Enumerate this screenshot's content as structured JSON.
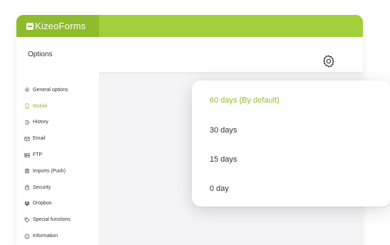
{
  "app": {
    "logo_text": "KizeoForms"
  },
  "header": {
    "title": "Options"
  },
  "sidebar": {
    "items": [
      {
        "label": "General options",
        "icon": "gear-icon"
      },
      {
        "label": "Mobile",
        "icon": "mobile-icon",
        "active": true
      },
      {
        "label": "History",
        "icon": "history-icon"
      },
      {
        "label": "Email",
        "icon": "email-icon"
      },
      {
        "label": "FTP",
        "icon": "server-icon"
      },
      {
        "label": "Imports (Push)",
        "icon": "import-icon"
      },
      {
        "label": "Security",
        "icon": "lock-icon"
      },
      {
        "label": "Dropbox",
        "icon": "dropbox-icon"
      },
      {
        "label": "Special functions",
        "icon": "tag-icon"
      },
      {
        "label": "Information",
        "icon": "info-icon"
      }
    ]
  },
  "dropdown": {
    "options": [
      "60 days (By default)",
      "30 days",
      "15 days",
      "0 day"
    ],
    "selected_index": 0
  },
  "colors": {
    "brand_green": "#a4cf3c",
    "brand_green_dark": "#8fbc2d",
    "background": "#f4f4f6"
  }
}
